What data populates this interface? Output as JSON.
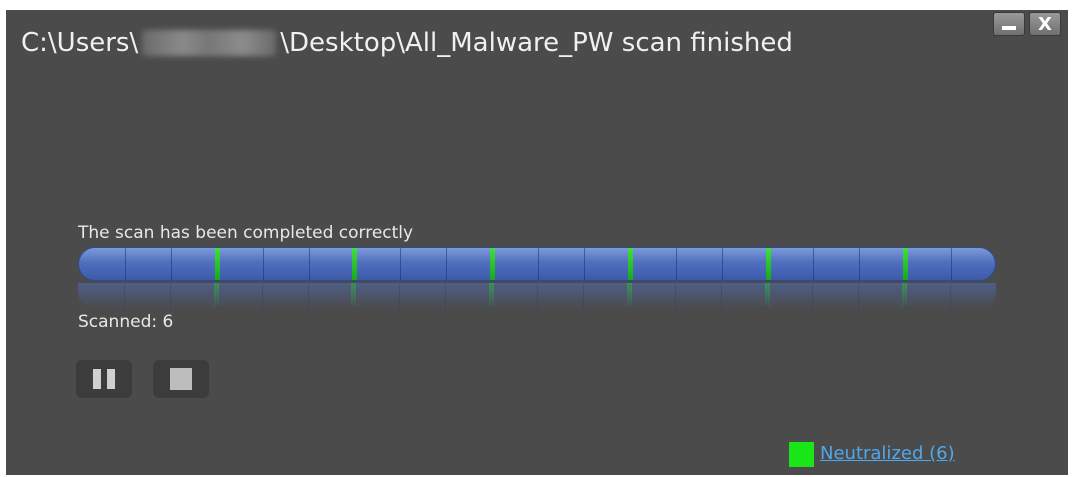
{
  "window": {
    "title_prefix": "C:\\Users\\",
    "title_suffix": "\\Desktop\\All_Malware_PW scan finished",
    "minimize_icon": "minimize-icon",
    "close_label": "X"
  },
  "scan": {
    "status_text": "The scan has been completed correctly",
    "scanned_text": "Scanned: 6",
    "progress_fraction": 1.0,
    "segments": 20,
    "colors": {
      "track": "#4f6fbf",
      "marker": "#22cc22"
    }
  },
  "controls": {
    "pause_icon": "pause-icon",
    "stop_icon": "stop-icon"
  },
  "legend": {
    "swatch_color": "#19e619",
    "label": "Neutralized (6)"
  }
}
